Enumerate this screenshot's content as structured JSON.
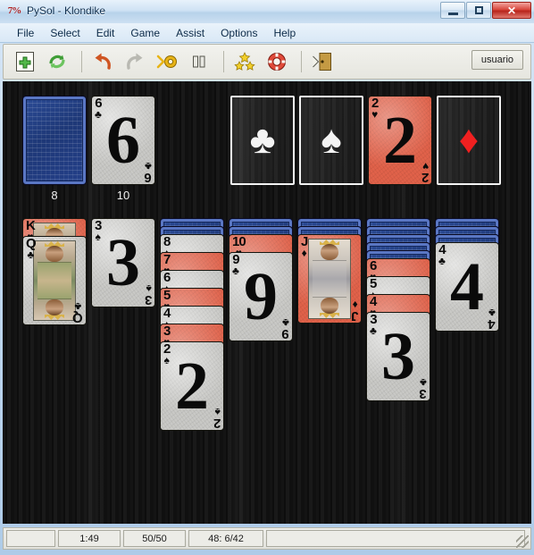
{
  "window": {
    "title": "PySol - Klondike",
    "app_icon": "pysol-icon",
    "controls": {
      "minimize": "–",
      "maximize": "□",
      "close": "✕"
    }
  },
  "menubar": {
    "items": [
      {
        "label": "File"
      },
      {
        "label": "Select"
      },
      {
        "label": "Edit"
      },
      {
        "label": "Game"
      },
      {
        "label": "Assist"
      },
      {
        "label": "Options"
      },
      {
        "label": "Help"
      }
    ]
  },
  "toolbar": {
    "buttons": [
      {
        "name": "new-game-button",
        "icon": "new-document-plus-icon",
        "label": "New"
      },
      {
        "name": "restart-game-button",
        "icon": "restart-recycle-icon",
        "label": "Restart"
      },
      {
        "name": "undo-button",
        "icon": "undo-arrow-icon",
        "label": "Undo"
      },
      {
        "name": "redo-button",
        "icon": "redo-arrow-icon",
        "label": "Redo"
      },
      {
        "name": "autodrop-button",
        "icon": "autodrop-icon",
        "label": "Autodrop"
      },
      {
        "name": "pause-button",
        "icon": "pause-icon",
        "label": "Pause"
      },
      {
        "name": "statistics-button",
        "icon": "stars-icon",
        "label": "Statistics"
      },
      {
        "name": "help-button",
        "icon": "lifebuoy-icon",
        "label": "Help"
      },
      {
        "name": "quit-button",
        "icon": "exit-door-icon",
        "label": "Quit"
      }
    ],
    "user_label": "usuario"
  },
  "board": {
    "stock": {
      "name": "stock-pile",
      "face_down": true,
      "count_label": "8"
    },
    "waste": {
      "name": "waste-pile",
      "card": {
        "rank": "6",
        "suit": "clubs",
        "pip": "♣",
        "color": "black"
      },
      "count_label": "10"
    },
    "foundations": [
      {
        "name": "foundation-clubs",
        "empty": true,
        "pip": "♣"
      },
      {
        "name": "foundation-spades",
        "empty": true,
        "pip": "♠"
      },
      {
        "name": "foundation-hearts",
        "empty": false,
        "card": {
          "rank": "2",
          "suit": "hearts",
          "pip": "♥",
          "color": "red"
        }
      },
      {
        "name": "foundation-diamonds",
        "empty": true,
        "pip": "♦"
      }
    ],
    "tableau": [
      {
        "name": "tableau-column-1",
        "face_down": 0,
        "cards": [
          {
            "rank": "K",
            "suit": "hearts",
            "pip": "♥",
            "color": "red",
            "court": "king"
          },
          {
            "rank": "Q",
            "suit": "clubs",
            "pip": "♣",
            "color": "black",
            "court": "queen"
          }
        ]
      },
      {
        "name": "tableau-column-2",
        "face_down": 0,
        "cards": [
          {
            "rank": "3",
            "suit": "spades",
            "pip": "♠",
            "color": "black"
          }
        ]
      },
      {
        "name": "tableau-column-3",
        "face_down": 2,
        "cards": [
          {
            "rank": "8",
            "suit": "spades",
            "pip": "♠",
            "color": "black"
          },
          {
            "rank": "7",
            "suit": "hearts",
            "pip": "♥",
            "color": "red"
          },
          {
            "rank": "6",
            "suit": "spades",
            "pip": "♠",
            "color": "black"
          },
          {
            "rank": "5",
            "suit": "hearts",
            "pip": "♥",
            "color": "red"
          },
          {
            "rank": "4",
            "suit": "spades",
            "pip": "♠",
            "color": "black"
          },
          {
            "rank": "3",
            "suit": "hearts",
            "pip": "♥",
            "color": "red"
          },
          {
            "rank": "2",
            "suit": "spades",
            "pip": "♠",
            "color": "black"
          }
        ]
      },
      {
        "name": "tableau-column-4",
        "face_down": 2,
        "cards": [
          {
            "rank": "10",
            "suit": "hearts",
            "pip": "♥",
            "color": "red"
          },
          {
            "rank": "9",
            "suit": "clubs",
            "pip": "♣",
            "color": "black"
          }
        ]
      },
      {
        "name": "tableau-column-5",
        "face_down": 2,
        "cards": [
          {
            "rank": "J",
            "suit": "diamonds",
            "pip": "♦",
            "color": "red",
            "court": "jack"
          }
        ]
      },
      {
        "name": "tableau-column-6",
        "face_down": 5,
        "cards": [
          {
            "rank": "6",
            "suit": "hearts",
            "pip": "♥",
            "color": "red"
          },
          {
            "rank": "5",
            "suit": "spades",
            "pip": "♠",
            "color": "black"
          },
          {
            "rank": "4",
            "suit": "hearts",
            "pip": "♥",
            "color": "red"
          },
          {
            "rank": "3",
            "suit": "clubs",
            "pip": "♣",
            "color": "black"
          }
        ]
      },
      {
        "name": "tableau-column-7",
        "face_down": 3,
        "cards": [
          {
            "rank": "4",
            "suit": "clubs",
            "pip": "♣",
            "color": "black"
          }
        ]
      }
    ]
  },
  "statusbar": {
    "cells": [
      {
        "name": "status-spacer",
        "text": ""
      },
      {
        "name": "status-time",
        "text": "1:49"
      },
      {
        "name": "status-moves",
        "text": "50/50"
      },
      {
        "name": "status-progress",
        "text": "48: 6/42"
      },
      {
        "name": "status-message",
        "text": ""
      }
    ],
    "grip": "resize-grip"
  }
}
